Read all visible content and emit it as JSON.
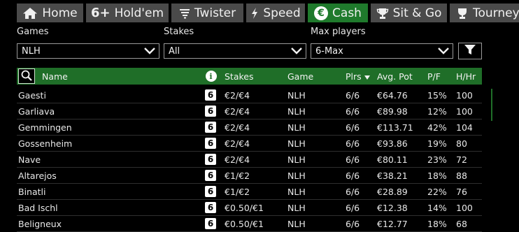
{
  "tabs": [
    {
      "label": "Home",
      "icon": "home-icon",
      "active": false
    },
    {
      "label": "Hold'em",
      "icon": "six-plus-icon",
      "active": false
    },
    {
      "label": "Twister",
      "icon": "tornado-icon",
      "active": false
    },
    {
      "label": "Speed",
      "icon": "lightning-icon",
      "active": false
    },
    {
      "label": "Cash",
      "icon": "euro-icon",
      "active": true
    },
    {
      "label": "Sit & Go",
      "icon": "trophy-icon",
      "active": false
    },
    {
      "label": "Tourney",
      "icon": "trophy-icon",
      "active": false
    }
  ],
  "tab_glyphs": {
    "six_plus": "6+",
    "euro": "€"
  },
  "filters": {
    "games": {
      "label": "Games",
      "value": "NLH"
    },
    "stakes": {
      "label": "Stakes",
      "value": "All"
    },
    "max_players": {
      "label": "Max players",
      "value": "6-Max"
    }
  },
  "table": {
    "headers": {
      "name": "Name",
      "info": "i",
      "stakes": "Stakes",
      "game": "Game",
      "plrs": "Plrs",
      "avg_pot": "Avg. Pot",
      "pf": "P/F",
      "hhr": "H/Hr"
    },
    "rows": [
      {
        "name": "Gaesti",
        "seats": "6",
        "stakes": "€2/€4",
        "game": "NLH",
        "plrs": "6/6",
        "avg_pot": "€64.76",
        "pf": "15%",
        "hhr": "100"
      },
      {
        "name": "Garliava",
        "seats": "6",
        "stakes": "€2/€4",
        "game": "NLH",
        "plrs": "6/6",
        "avg_pot": "€89.98",
        "pf": "12%",
        "hhr": "100"
      },
      {
        "name": "Gemmingen",
        "seats": "6",
        "stakes": "€2/€4",
        "game": "NLH",
        "plrs": "6/6",
        "avg_pot": "€113.71",
        "pf": "42%",
        "hhr": "104"
      },
      {
        "name": "Gossenheim",
        "seats": "6",
        "stakes": "€2/€4",
        "game": "NLH",
        "plrs": "6/6",
        "avg_pot": "€93.86",
        "pf": "19%",
        "hhr": "80"
      },
      {
        "name": "Nave",
        "seats": "6",
        "stakes": "€2/€4",
        "game": "NLH",
        "plrs": "6/6",
        "avg_pot": "€80.11",
        "pf": "23%",
        "hhr": "72"
      },
      {
        "name": "Altarejos",
        "seats": "6",
        "stakes": "€1/€2",
        "game": "NLH",
        "plrs": "6/6",
        "avg_pot": "€38.21",
        "pf": "18%",
        "hhr": "88"
      },
      {
        "name": "Binatli",
        "seats": "6",
        "stakes": "€1/€2",
        "game": "NLH",
        "plrs": "6/6",
        "avg_pot": "€28.89",
        "pf": "22%",
        "hhr": "76"
      },
      {
        "name": "Bad Ischl",
        "seats": "6",
        "stakes": "€0.50/€1",
        "game": "NLH",
        "plrs": "6/6",
        "avg_pot": "€12.38",
        "pf": "14%",
        "hhr": "100"
      },
      {
        "name": "Beligneux",
        "seats": "6",
        "stakes": "€0.50/€1",
        "game": "NLH",
        "plrs": "6/6",
        "avg_pot": "€12.77",
        "pf": "18%",
        "hhr": "68"
      }
    ]
  },
  "colors": {
    "accent_green": "#1f7a2c",
    "header_green": "#1f6e28",
    "tab_gray": "#4a4a4a",
    "background": "#000000"
  }
}
